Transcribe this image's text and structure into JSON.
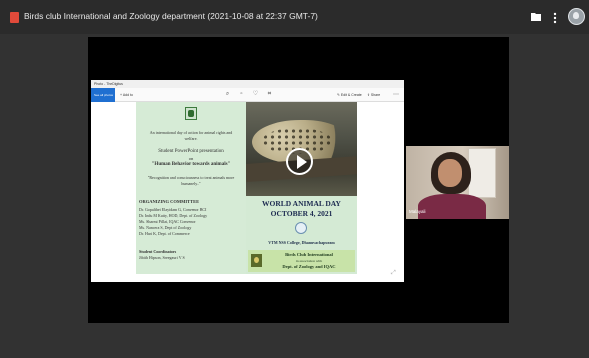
{
  "window": {
    "title": "Birds club International and Zoology department (2021-10-08 at 22:37 GMT-7)"
  },
  "shared_screen": {
    "app_title": "Photo - TheDigitus",
    "toolbar": {
      "home_label": "See all photos",
      "add_to_label": "Add to",
      "edit_create_label": "Edit & Create",
      "share_label": "Share"
    },
    "poster": {
      "left": {
        "intro_line1": "An international day of action for animal rights and",
        "intro_line2": "welfare.",
        "presentation_line1": "Student PowerPoint presentation",
        "presentation_line2": "on",
        "topic": "\"Human Behavior towards animals\"",
        "quote_line1": "\"Recognition and consciousness to treat animals more",
        "quote_line2": "humanely..\"",
        "committee_heading": "ORGANIZING COMMITTEE",
        "committee": [
          "Dr. Gopalthei Elayidam G, Convenor BCI",
          "Dr. Indu M Kutty, HOD, Dept. of Zoology",
          "Ms. Sharmi Pillai, IQAC Convenor",
          "Ms. Nancera S, Dept of Zoology",
          "Dr. Hari K, Dept. of Commerce"
        ],
        "coordinators_heading": "Student Coordinators",
        "coordinators": "Jibith Hipson, Sreegauri V S"
      },
      "right": {
        "event_title": "WORLD ANIMAL DAY",
        "event_date": "OCTOBER 4, 2021",
        "college": "VTM NSS College, Dhanuvachapuram",
        "club_name": "Birds Club International",
        "club_assoc": "in association with",
        "club_dept": "Dept. of Zoology and IQAC"
      }
    }
  },
  "participant": {
    "name": "Malayali"
  }
}
